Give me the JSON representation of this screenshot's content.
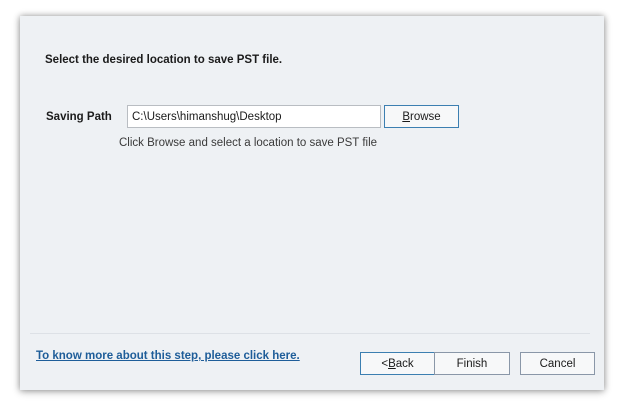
{
  "heading": "Select the desired location to save PST file.",
  "saving_path": {
    "label": "Saving Path",
    "value": "C:\\Users\\himanshug\\Desktop",
    "browse_prefix": "",
    "browse_mnemonic": "B",
    "browse_suffix": "rowse",
    "hint": "Click Browse and select a location to save PST file"
  },
  "footer": {
    "help_link": "To know more about this step, please click here.",
    "back_prefix": "< ",
    "back_mnemonic": "B",
    "back_suffix": "ack",
    "finish_label": "Finish",
    "cancel_label": "Cancel"
  }
}
